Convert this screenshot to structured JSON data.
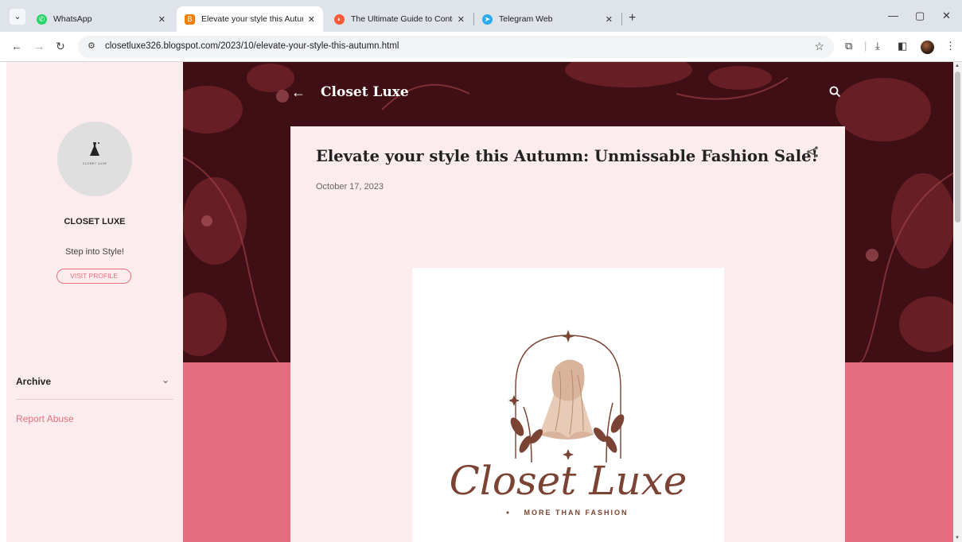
{
  "browser": {
    "tabs": [
      {
        "title": "WhatsApp",
        "favicon_color": "#25d366",
        "icon": "whatsapp-icon"
      },
      {
        "title": "Elevate your style this Autumn",
        "favicon_color": "#f57d00",
        "icon": "blogger-icon"
      },
      {
        "title": "The Ultimate Guide to Content",
        "favicon_color": "#ff5a36",
        "icon": "hubspot-icon"
      },
      {
        "title": "Telegram Web",
        "favicon_color": "#2aabee",
        "icon": "telegram-icon"
      }
    ],
    "url": "closetluxe326.blogspot.com/2023/10/elevate-your-style-this-autumn.html"
  },
  "sidebar": {
    "profile_name": "CLOSET LUXE",
    "tagline": "Step into Style!",
    "visit_profile": "VISIT PROFILE",
    "logo_mini_text": "CLOSET LUXE",
    "archive": "Archive",
    "report_abuse": "Report Abuse"
  },
  "header": {
    "blog_title": "Closet Luxe"
  },
  "post": {
    "title": "Elevate your style this Autumn: Unmissable Fashion Sale!",
    "date": "October 17, 2023",
    "image": {
      "script_text": "Closet Luxe",
      "tagline": "MORE THAN FASHION"
    }
  },
  "colors": {
    "accent_pink": "#e56d80",
    "banner_dark": "#3f0f15",
    "card_bg": "#fdeced",
    "logo_brown": "#7a4333"
  }
}
